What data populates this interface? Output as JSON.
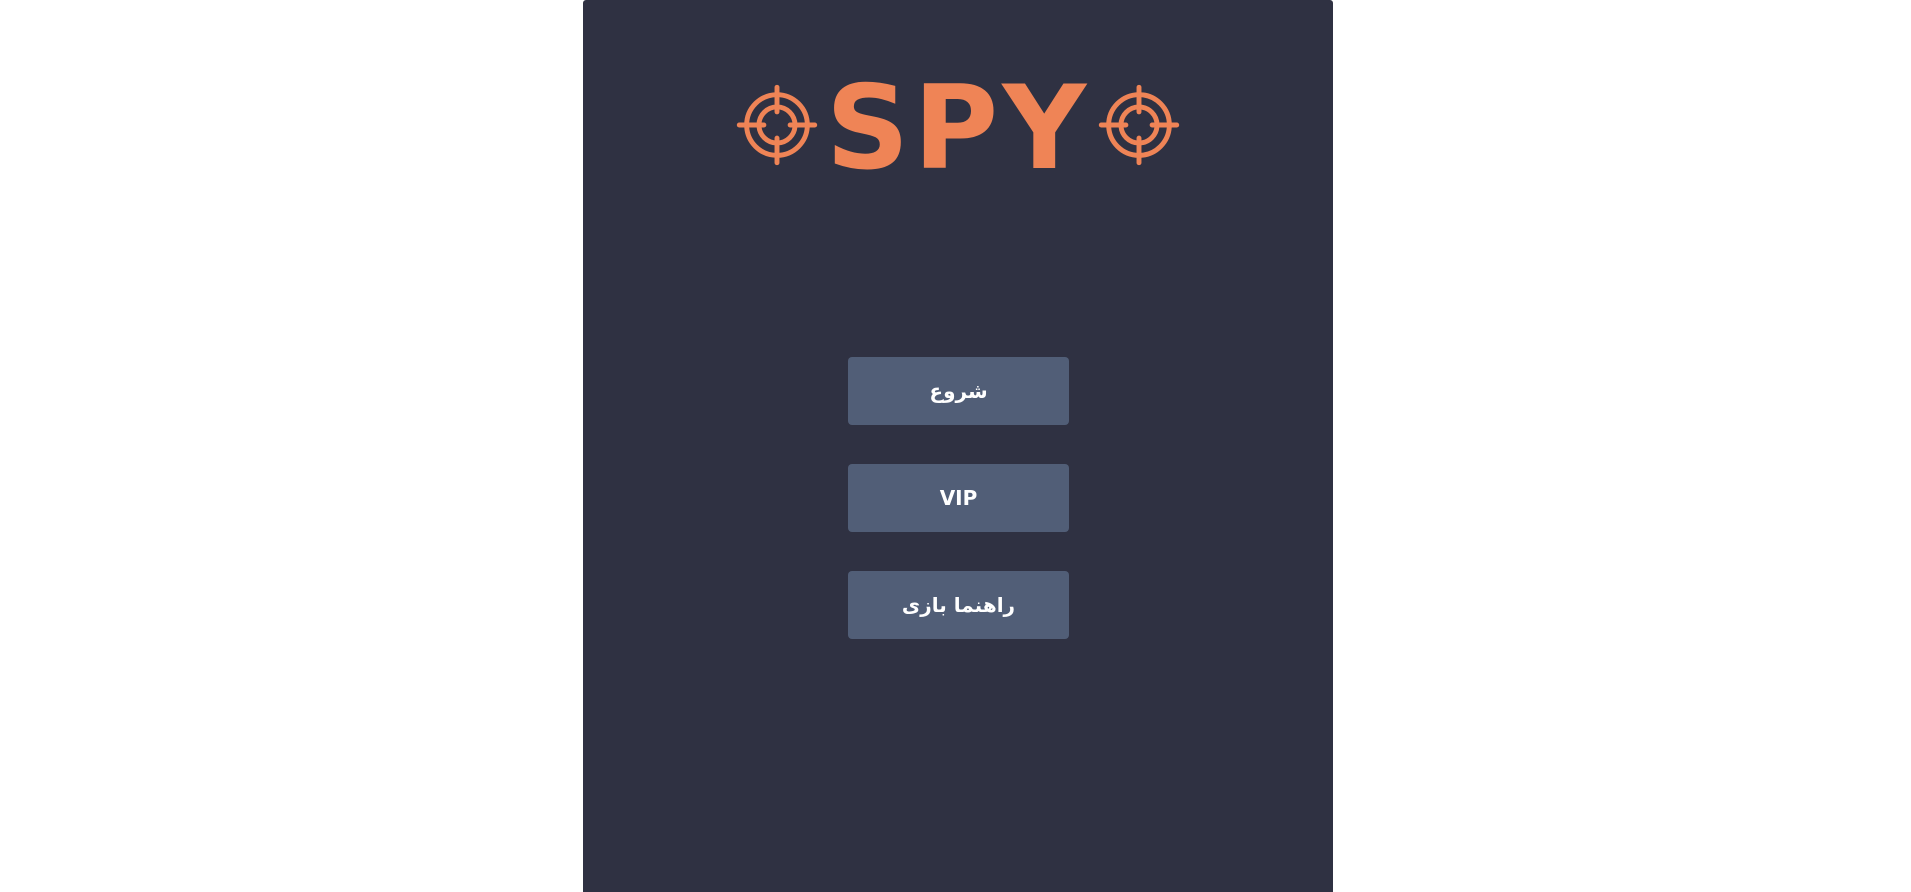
{
  "logo": {
    "text": "SPY",
    "color": "#ef8456",
    "left_icon": "crosshair-icon",
    "right_icon": "crosshair-icon"
  },
  "menu": {
    "start_label": "شروع",
    "vip_label": "VIP",
    "guide_label": "راهنما بازی"
  },
  "colors": {
    "panel_background": "#2f3142",
    "button_background": "#515e77",
    "button_text": "#ffffff",
    "page_background": "#ffffff"
  }
}
